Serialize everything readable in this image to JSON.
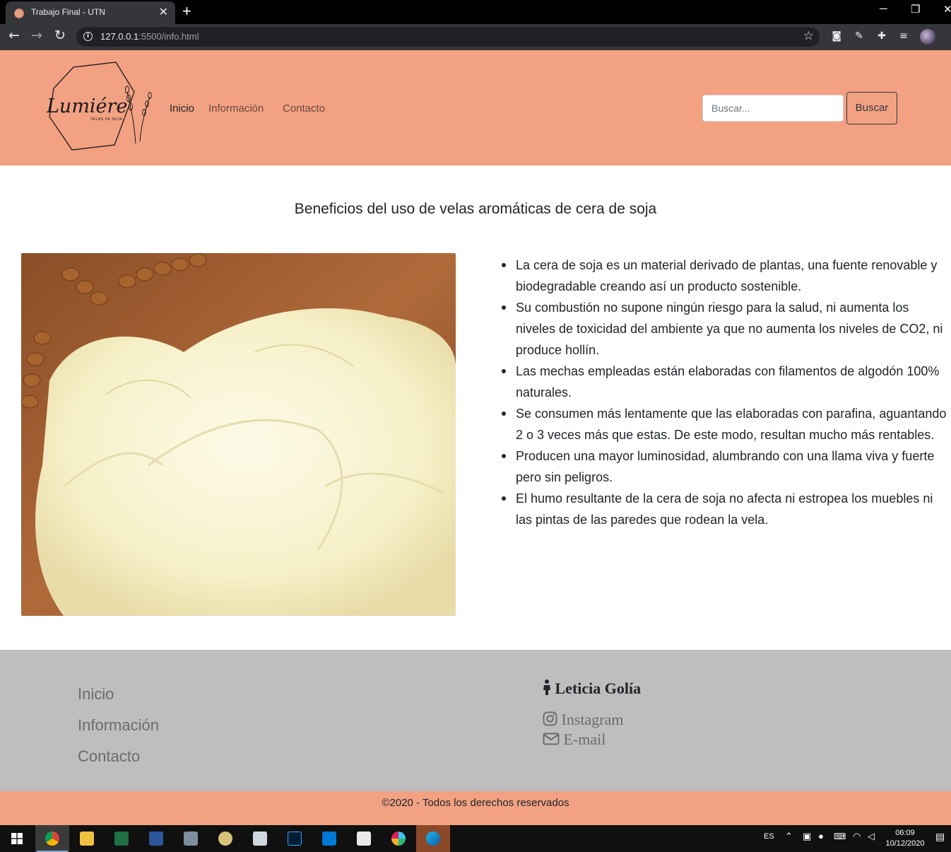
{
  "browser": {
    "tab_title": "Trabajo Final - UTN",
    "tab_close": "✕",
    "new_tab": "+",
    "url_host": "127.0.0.1",
    "url_rest": ":5500/info.html",
    "window_controls": [
      "─",
      "❐",
      "✕"
    ]
  },
  "header": {
    "logo_text": "Lumiére",
    "logo_subtext": "VELAS DE SOJA",
    "nav": [
      {
        "label": "Inicio",
        "active": true
      },
      {
        "label": "Información",
        "active": false
      },
      {
        "label": "Contacto",
        "active": false
      }
    ],
    "search_placeholder": "Buscar...",
    "search_button": "Buscar",
    "accent_color": "#f2a183"
  },
  "main": {
    "title": "Beneficios del uso de velas aromáticas de cera de soja",
    "benefits": [
      "La cera de soja es un material derivado de plantas, una fuente renovable y biodegradable creando así un producto sostenible.",
      "Su combustión no supone ningún riesgo para la salud, ni aumenta los niveles de toxicidad del ambiente ya que no aumenta los niveles de CO2, ni produce hollín.",
      "Las mechas empleadas están elaboradas con filamentos de algodón 100% naturales.",
      "Se consumen más lentamente que las elaboradas con parafina, aguantando 2 o 3 veces más que estas. De este modo, resultan mucho más rentables.",
      "Producen una mayor luminosidad, alumbrando con una llama viva y fuerte pero sin peligros.",
      "El humo resultante de la cera de soja no afecta ni estropea los muebles ni las pintas de las paredes que rodean la vela."
    ]
  },
  "footer": {
    "links": [
      "Inicio",
      "Información",
      "Contacto"
    ],
    "author": "Leticia Golía",
    "social": [
      {
        "label": "Instagram",
        "icon": "instagram-icon"
      },
      {
        "label": "E-mail",
        "icon": "envelope-icon"
      }
    ],
    "copyright": "©2020 - Todos los derechos reservados",
    "background_color": "#bebebe"
  },
  "taskbar": {
    "language": "ES",
    "time": "06:09",
    "date": "10/12/2020",
    "apps": [
      "chrome",
      "file-explorer",
      "excel",
      "word",
      "calculator",
      "paint",
      "sketchup",
      "photoshop",
      "vscode",
      "acrobat",
      "slack",
      "edge"
    ]
  }
}
